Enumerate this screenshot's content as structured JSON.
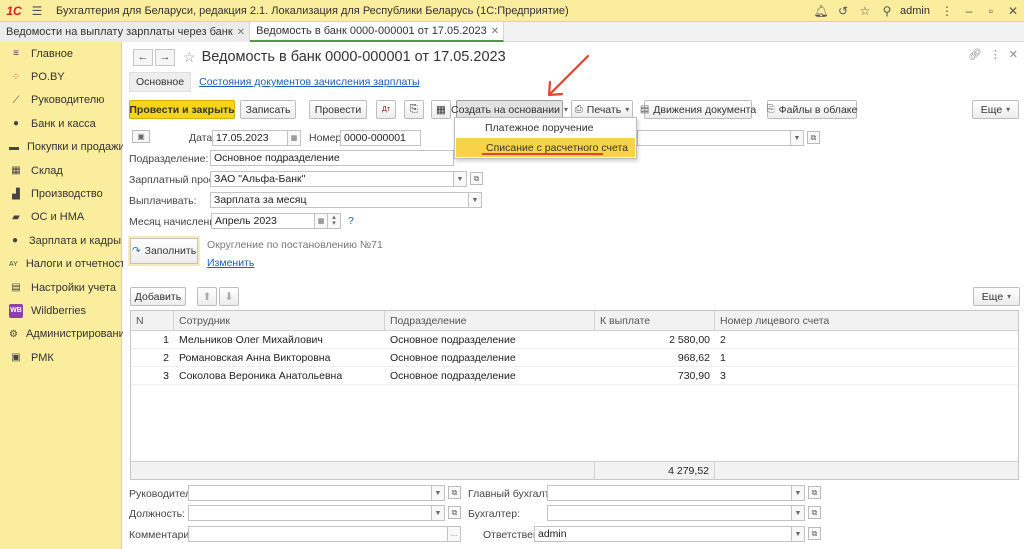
{
  "titlebar": {
    "logo": "1С",
    "app_title": "Бухгалтерия для Беларуси, редакция 2.1. Локализация для Республики Беларусь   (1С:Предприятие)",
    "user": "admin"
  },
  "tabs": [
    {
      "label": "Ведомости на выплату зарплаты через банк"
    },
    {
      "label": "Ведомость в банк 0000-000001 от 17.05.2023"
    }
  ],
  "sidebar": {
    "items": [
      {
        "label": "Главное",
        "icon": "menu-icon"
      },
      {
        "label": "PO.BY",
        "icon": "poby-icon"
      },
      {
        "label": "Руководителю",
        "icon": "trend-icon"
      },
      {
        "label": "Банк и касса",
        "icon": "coin-icon"
      },
      {
        "label": "Покупки и продажи",
        "icon": "cart-icon"
      },
      {
        "label": "Склад",
        "icon": "warehouse-icon"
      },
      {
        "label": "Производство",
        "icon": "factory-icon"
      },
      {
        "label": "ОС и НМА",
        "icon": "truck-icon"
      },
      {
        "label": "Зарплата и кадры",
        "icon": "person-icon"
      },
      {
        "label": "Налоги и отчетность",
        "icon": "tax-icon"
      },
      {
        "label": "Настройки учета",
        "icon": "settings-doc-icon"
      },
      {
        "label": "Wildberries",
        "icon": "wb-icon"
      },
      {
        "label": "Администрирование",
        "icon": "gear-icon"
      },
      {
        "label": "РМК",
        "icon": "pos-icon"
      }
    ]
  },
  "doc": {
    "title": "Ведомость в банк 0000-000001 от 17.05.2023",
    "subnav_main": "Основное",
    "subnav_link": "Состояния документов зачисления зарплаты"
  },
  "toolbar": {
    "post_close": "Провести и закрыть",
    "save": "Записать",
    "post": "Провести",
    "create_based": "Создать на основании",
    "print": "Печать",
    "movements": "Движения документа",
    "cloud_files": "Файлы в облаке",
    "more": "Еще"
  },
  "dropdown": {
    "items": [
      "Платежное поручение",
      "Списание с расчетного счета"
    ]
  },
  "form": {
    "date_label": "Дата:",
    "date_value": "17.05.2023",
    "number_label": "Номер:",
    "number_value": "0000-000001",
    "dept_label": "Подразделение:",
    "dept_value": "Основное подразделение",
    "project_label": "Зарплатный проект:",
    "project_value": "ЗАО \"Альфа-Банк\"",
    "pay_label": "Выплачивать:",
    "pay_value": "Зарплата за месяц",
    "month_label": "Месяц начисления:",
    "month_value": "Апрель 2023",
    "help": "?",
    "fill_button": "Заполнить",
    "rounding_note": "Округление по постановлению №71",
    "change_link": "Изменить"
  },
  "table_toolbar": {
    "add": "Добавить",
    "more": "Еще"
  },
  "table": {
    "headers": [
      "N",
      "Сотрудник",
      "Подразделение",
      "К выплате",
      "Номер лицевого счета"
    ],
    "rows": [
      [
        "1",
        "Мельников Олег Михайлович",
        "Основное подразделение",
        "2 580,00",
        "2"
      ],
      [
        "2",
        "Романовская Анна Викторовна",
        "Основное подразделение",
        "968,62",
        "1"
      ],
      [
        "3",
        "Соколова Вероника Анатольевна",
        "Основное подразделение",
        "730,90",
        "3"
      ]
    ],
    "total": "4 279,52"
  },
  "footer": {
    "head_label": "Руководитель:",
    "position_label": "Должность:",
    "comment_label": "Комментарий:",
    "chief_acc_label": "Главный бухгалтер:",
    "accountant_label": "Бухгалтер:",
    "responsible_label": "Ответственный:",
    "responsible_value": "admin"
  },
  "colors": {
    "sidebar_bg": "#fbed9e",
    "primary_button": "#f5d41a",
    "highlight": "#f7d347",
    "arrow": "#e2442f",
    "link": "#1d5fb4"
  }
}
